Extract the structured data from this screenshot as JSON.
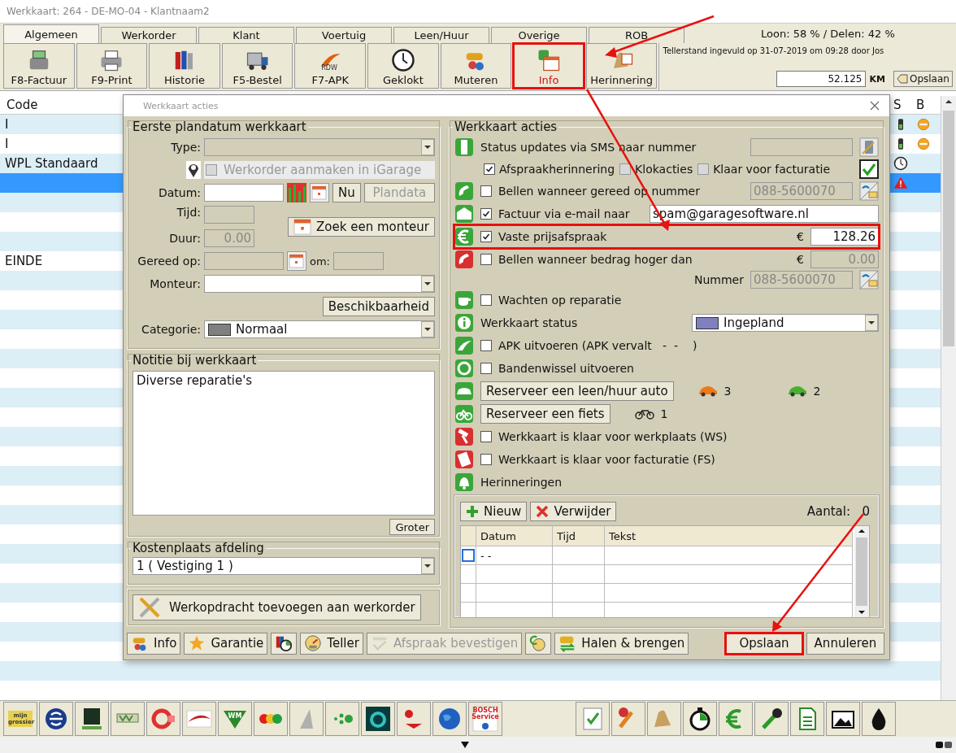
{
  "window": {
    "title": "Werkkaart: 264 - DE-MO-04 - Klantnaam2"
  },
  "tabs": [
    {
      "label": "Algemeen",
      "selected": true
    },
    {
      "label": "Werkorder",
      "selected": false
    },
    {
      "label": "Klant",
      "selected": false
    },
    {
      "label": "Voertuig",
      "selected": false
    },
    {
      "label": "Leen/Huur",
      "selected": false
    },
    {
      "label": "Overige",
      "selected": false
    },
    {
      "label": "ROB",
      "selected": false
    }
  ],
  "summary": "Loon: 58 % / Delen: 42 %",
  "toolbar": [
    {
      "label": "F8-Factuur",
      "kind": "register",
      "highlighted": false
    },
    {
      "label": "F9-Print",
      "kind": "printer",
      "highlighted": false
    },
    {
      "label": "Historie",
      "kind": "books",
      "highlighted": false
    },
    {
      "label": "F5-Bestel",
      "kind": "truck",
      "highlighted": false
    },
    {
      "label": "F7-APK",
      "kind": "rdw",
      "logo_text": "RDW",
      "highlighted": false
    },
    {
      "label": "Geklokt",
      "kind": "clock",
      "highlighted": false
    },
    {
      "label": "Muteren",
      "kind": "car-people",
      "highlighted": false
    },
    {
      "label": "Info",
      "kind": "info-calendar",
      "highlighted": true
    },
    {
      "label": "Herinnering",
      "kind": "bell-calendar",
      "highlighted": false
    }
  ],
  "odometer": {
    "note": "Tellerstand ingevuld op 31-07-2019 om 09:28 door Jos",
    "value": "52.125",
    "unit": "KM",
    "save": "Opslaan"
  },
  "table": {
    "columns": [
      {
        "kind": "code",
        "label": "Code"
      },
      {
        "kind": "s",
        "label": "S"
      },
      {
        "kind": "b",
        "label": "B"
      }
    ],
    "rows": [
      {
        "code": "I",
        "selected": false,
        "s": {
          "kind": "battery"
        },
        "b": {
          "kind": "minus"
        }
      },
      {
        "code": "I",
        "selected": false,
        "s": {
          "kind": "battery"
        },
        "b": {
          "kind": "minus"
        }
      },
      {
        "code": "WPL Standaard",
        "selected": false,
        "s": {
          "kind": "clock"
        }
      },
      {
        "selected": true,
        "s": {
          "kind": "warning"
        }
      },
      {
        "selected": false
      },
      {
        "selected": false
      },
      {
        "selected": false
      },
      {
        "code": "EINDE",
        "selected": false
      }
    ]
  },
  "dialog": {
    "title": "Werkkaart acties",
    "planning": {
      "legend": "Eerste plandatum werkkaart",
      "type_label": "Type:",
      "igarage": {
        "label": "Werkorder aanmaken in iGarage",
        "checked": false,
        "disabled": true
      },
      "datum_label": "Datum:",
      "now_button": "Nu",
      "plandata_button": "Plandata",
      "tijd_label": "Tijd:",
      "search_button": "Zoek een monteur",
      "duur_label": "Duur:",
      "duur_value": "0.00",
      "gereed_label": "Gereed op:",
      "om_label": "om:",
      "monteur_label": "Monteur:",
      "availability_button": "Beschikbaarheid",
      "categorie_label": "Categorie:",
      "categorie": {
        "value": "Normaal",
        "color": "#808080"
      }
    },
    "note": {
      "legend": "Notitie bij werkkaart",
      "text": "Diverse reparatie's",
      "button": "Groter"
    },
    "cost": {
      "legend": "Kostenplaats afdeling",
      "value": "1 ( Vestiging 1 )"
    },
    "add_button": "Werkopdracht toevoegen aan werkorder",
    "actions": {
      "legend": "Werkkaart acties",
      "rows": [
        {
          "kind": "text",
          "label": "Status updates via SMS naar nummer",
          "field": {
            "disabled": true
          },
          "action": {
            "kind": "phone-pen"
          }
        },
        {
          "kind": "options",
          "options": [
            {
              "label": "Afspraakherinnering",
              "checked": true,
              "disabled": false
            },
            {
              "label": "Klokacties",
              "checked": false,
              "disabled": true
            },
            {
              "label": "Klaar voor facturatie",
              "checked": false,
              "disabled": true
            }
          ],
          "approved": true
        },
        {
          "kind": "check",
          "label": "Bellen wanneer gereed op nummer",
          "checked": false,
          "field": {
            "value": "088-5600070",
            "disabled": true
          },
          "action": {
            "kind": "phone-mail"
          }
        },
        {
          "kind": "check",
          "label": "Factuur via e-mail naar",
          "checked": true,
          "field": {
            "value": "spam@garagesoftware.nl",
            "disabled": false
          }
        },
        {
          "kind": "check",
          "label": "Vaste prijsafspraak",
          "checked": true,
          "highlighted": true,
          "currency": "€",
          "field": {
            "value": "128.26",
            "disabled": false
          }
        },
        {
          "kind": "check",
          "label": "Bellen wanneer bedrag hoger dan",
          "checked": false,
          "currency": "€",
          "field": {
            "value": "0.00",
            "disabled": true
          }
        },
        {
          "kind": "number",
          "label": "Nummer",
          "field": {
            "value": "088-5600070",
            "disabled": true
          },
          "action": {
            "kind": "phone-mail"
          }
        },
        {
          "kind": "check",
          "label": "Wachten op reparatie",
          "checked": false
        },
        {
          "kind": "dropdown",
          "label": "Werkkaart status",
          "value": "Ingepland",
          "color": "#8080c0"
        },
        {
          "kind": "check",
          "label": "APK uitvoeren (APK vervalt   -  -    )",
          "checked": false
        },
        {
          "kind": "check",
          "label": "Bandenwissel uitvoeren",
          "checked": false
        },
        {
          "kind": "button",
          "label": "Reserveer een leen/huur auto",
          "counts": [
            {
              "kind": "car",
              "color": "#f07818",
              "value": "3"
            },
            {
              "kind": "car",
              "color": "#48b030",
              "value": "2"
            }
          ]
        },
        {
          "kind": "button",
          "label": "Reserveer een fiets",
          "counts": [
            {
              "kind": "bike",
              "value": "1"
            }
          ]
        },
        {
          "kind": "check",
          "label": "Werkkaart is klaar voor werkplaats (WS)",
          "checked": false
        },
        {
          "kind": "check",
          "label": "Werkkaart is klaar voor facturatie (FS)",
          "checked": false
        },
        {
          "kind": "text",
          "label": "Herinneringen"
        }
      ]
    },
    "reminders": {
      "new_button": "Nieuw",
      "delete_button": "Verwijder",
      "count_label": "Aantal:",
      "count": "0",
      "columns": [
        "Datum",
        "Tijd",
        "Tekst"
      ],
      "rows": [
        {
          "datum": "-  -",
          "checked": false
        }
      ]
    },
    "footer": [
      {
        "label": "Info",
        "kind": "car-people",
        "disabled": false
      },
      {
        "label": "Garantie",
        "kind": "star",
        "disabled": false
      },
      {
        "kind": "books-clock",
        "disabled": false
      },
      {
        "label": "Teller",
        "kind": "gauge",
        "disabled": false
      },
      {
        "label": "Afspraak bevestigen",
        "kind": "check-doc",
        "disabled": true
      },
      {
        "kind": "euro-gauge",
        "disabled": false
      },
      {
        "label": "Halen & brengen",
        "kind": "car-arrows",
        "disabled": false
      }
    ],
    "buttons": [
      {
        "label": "Opslaan",
        "highlighted": true
      },
      {
        "label": "Annuleren",
        "highlighted": false
      }
    ]
  },
  "taskbar": [
    {
      "kind": "text-logo",
      "label": "mijn grossier"
    },
    {
      "kind": "e-logo"
    },
    {
      "kind": "dark-logo"
    },
    {
      "kind": "green-logo"
    },
    {
      "kind": "red-ring"
    },
    {
      "kind": "swoosh"
    },
    {
      "kind": "wm",
      "label": "WM"
    },
    {
      "kind": "blobs"
    },
    {
      "kind": "grey-shape"
    },
    {
      "kind": "dots"
    },
    {
      "kind": "teal-ring"
    },
    {
      "kind": "red-logo"
    },
    {
      "kind": "globe"
    },
    {
      "kind": "bosch",
      "label": "BOSCH Service"
    },
    {
      "kind": "gap"
    },
    {
      "kind": "checklist"
    },
    {
      "kind": "tools"
    },
    {
      "kind": "bell"
    },
    {
      "kind": "stopwatch"
    },
    {
      "kind": "euro"
    },
    {
      "kind": "wrench"
    },
    {
      "kind": "document"
    },
    {
      "kind": "pictures"
    },
    {
      "kind": "drop"
    }
  ]
}
